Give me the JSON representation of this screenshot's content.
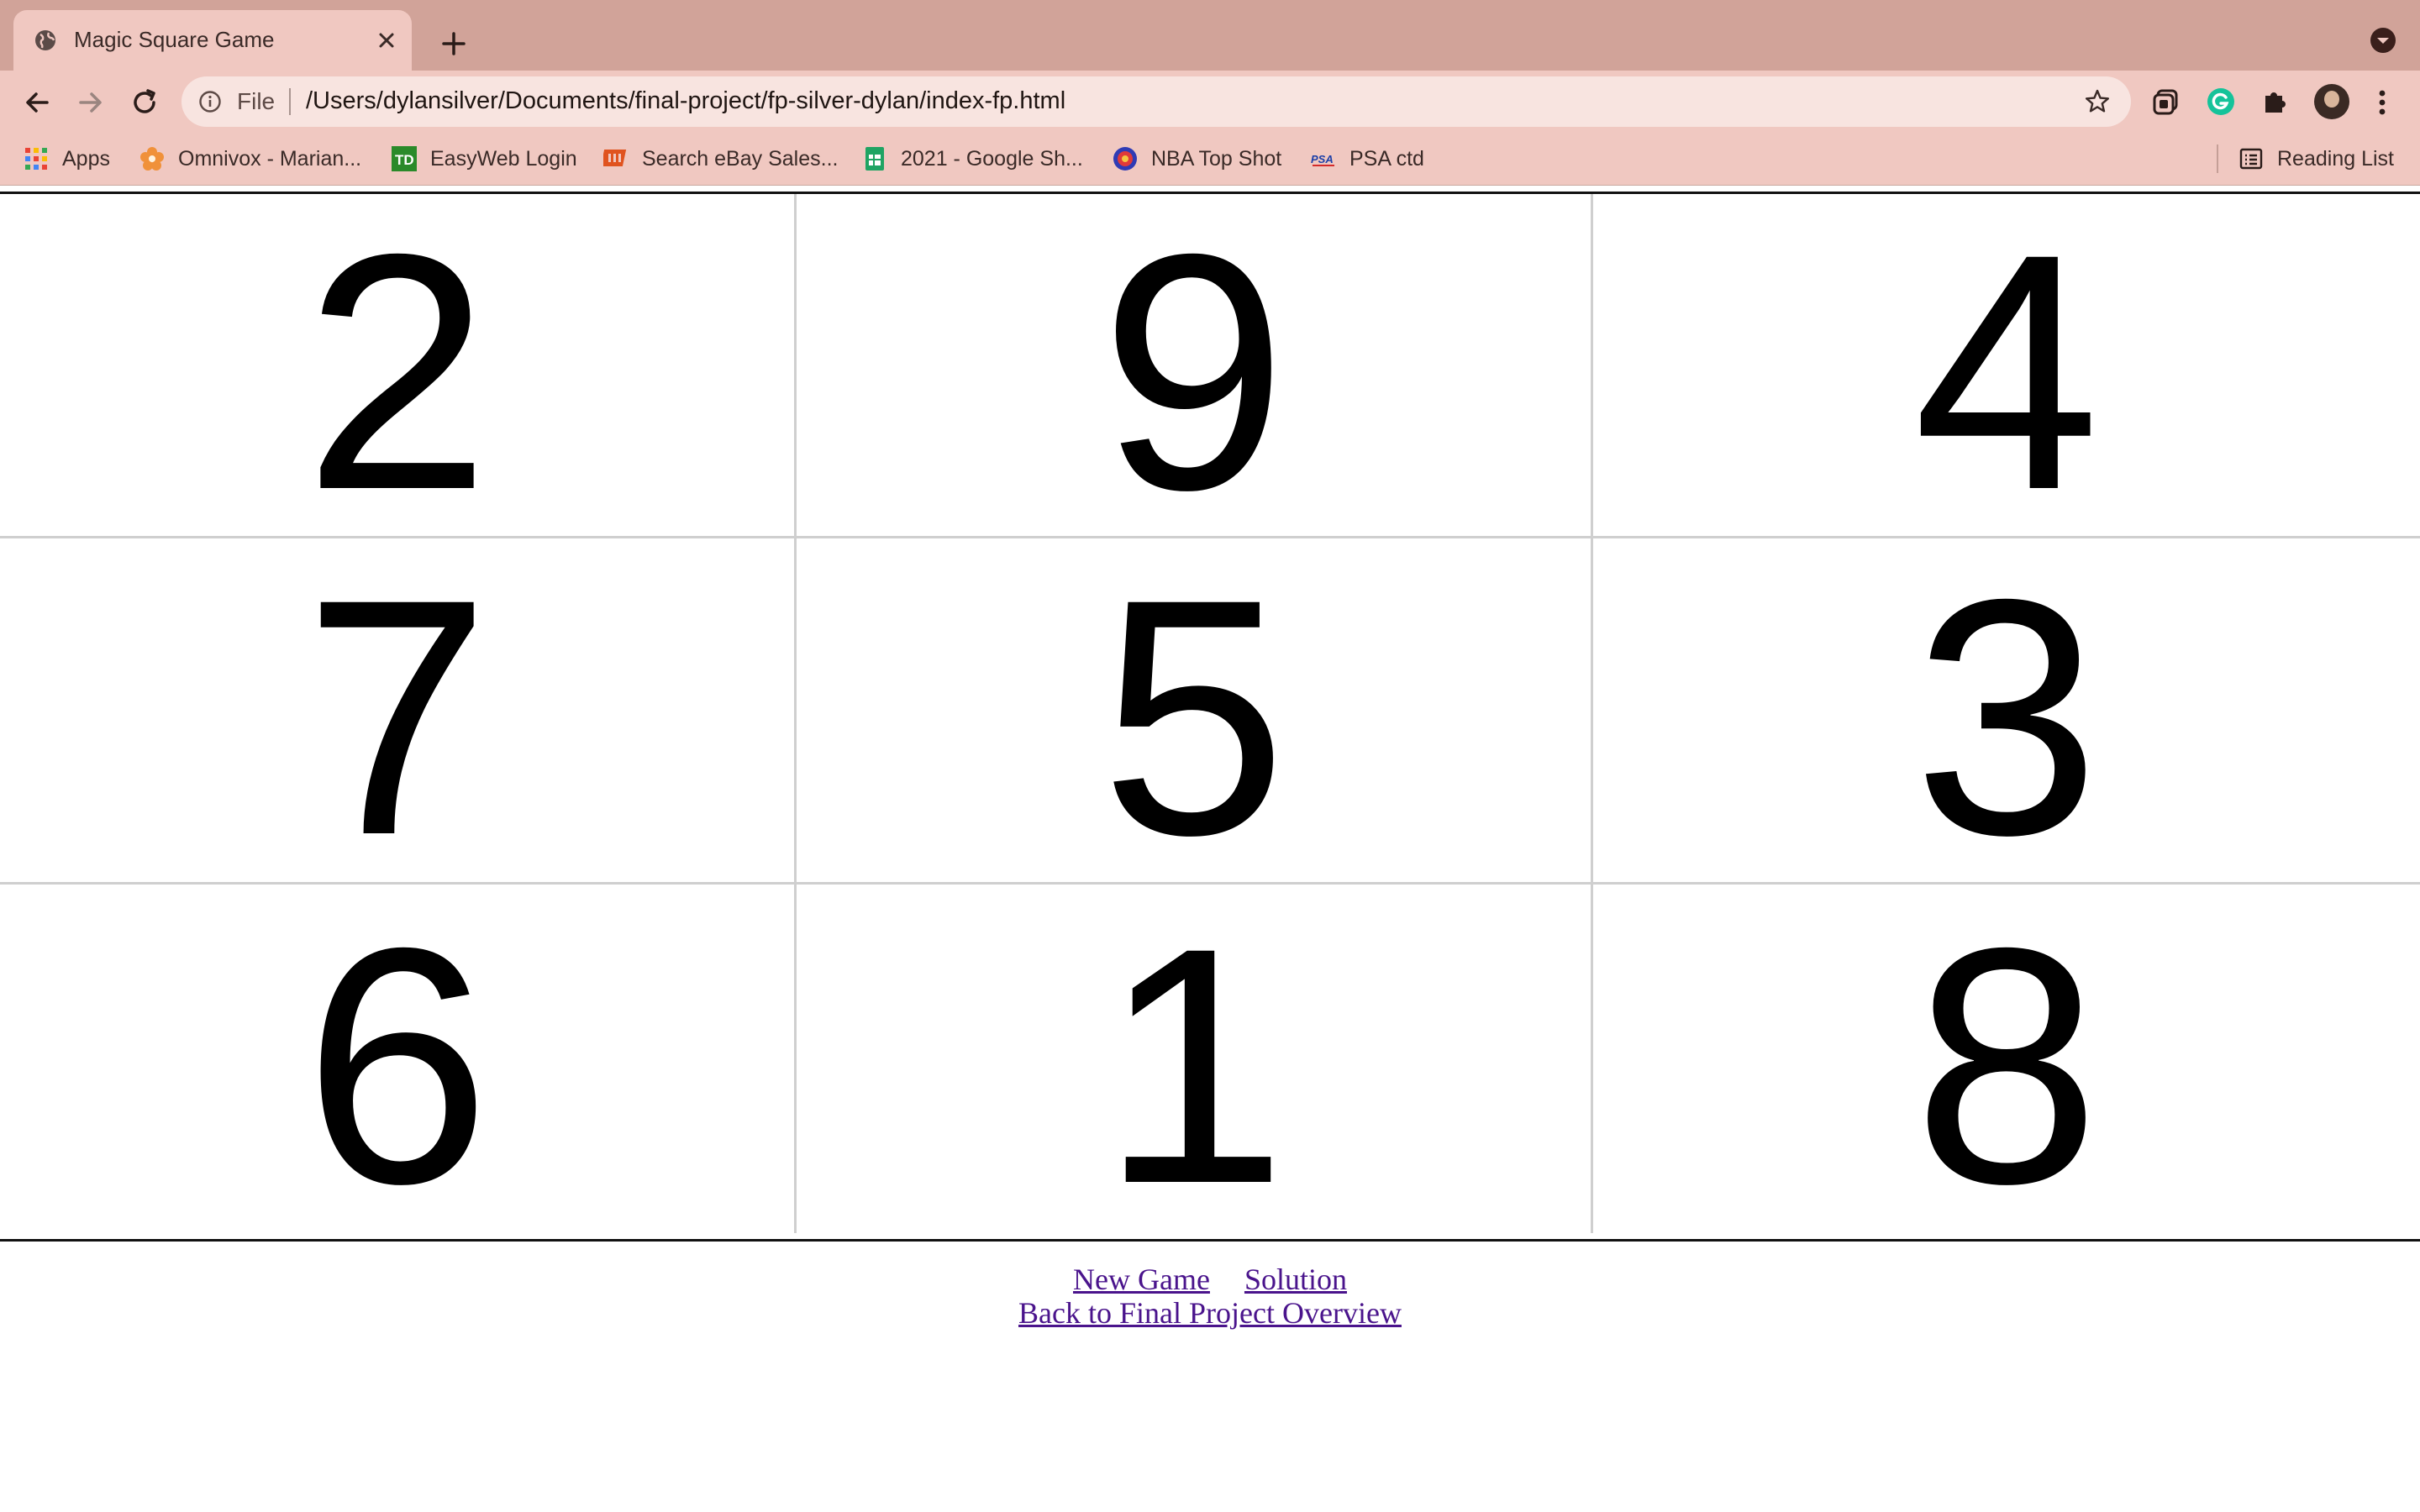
{
  "browser": {
    "tab_title": "Magic Square Game",
    "omnibox": {
      "scheme_label": "File",
      "url": "/Users/dylansilver/Documents/final-project/fp-silver-dylan/index-fp.html"
    },
    "bookmarks": [
      {
        "label": "Apps",
        "icon": "apps-grid-icon"
      },
      {
        "label": "Omnivox - Marian...",
        "icon": "omnivox-flower-icon"
      },
      {
        "label": "EasyWeb Login",
        "icon": "td-bank-icon"
      },
      {
        "label": "Search eBay Sales...",
        "icon": "130point-icon"
      },
      {
        "label": "2021 - Google Sh...",
        "icon": "google-sheets-icon"
      },
      {
        "label": "NBA Top Shot",
        "icon": "nba-top-shot-icon"
      },
      {
        "label": "PSA ctd",
        "icon": "psa-icon"
      }
    ],
    "reading_list": "Reading List",
    "colors": {
      "tabstrip": "#d1a399",
      "toolbar": "#f0c8c1",
      "omnibox": "#f8e4e0"
    }
  },
  "game": {
    "cells": [
      "2",
      "9",
      "4",
      "7",
      "5",
      "3",
      "6",
      "1",
      "8"
    ]
  },
  "links": {
    "new_game": "New Game",
    "solution": "Solution",
    "back": "Back to Final Project Overview",
    "color": "#4a148c"
  }
}
